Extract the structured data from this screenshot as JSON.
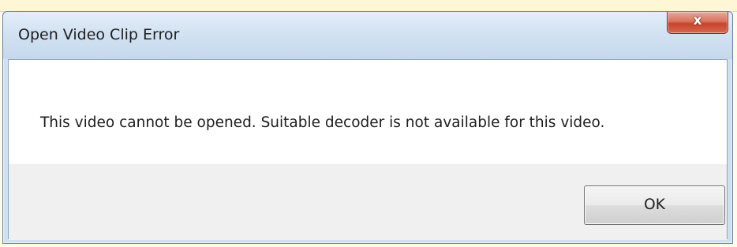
{
  "window": {
    "title": "Open Video Clip Error",
    "close_glyph": "x",
    "close_icon": "close-icon"
  },
  "dialog": {
    "message": "This video cannot be opened. Suitable decoder is not available for this video."
  },
  "buttons": {
    "ok_label": "OK"
  },
  "colors": {
    "titlebar": "#d2e2f2",
    "close_button": "#c7432b",
    "content_background": "#ffffff",
    "button_area": "#f0f0f0"
  }
}
